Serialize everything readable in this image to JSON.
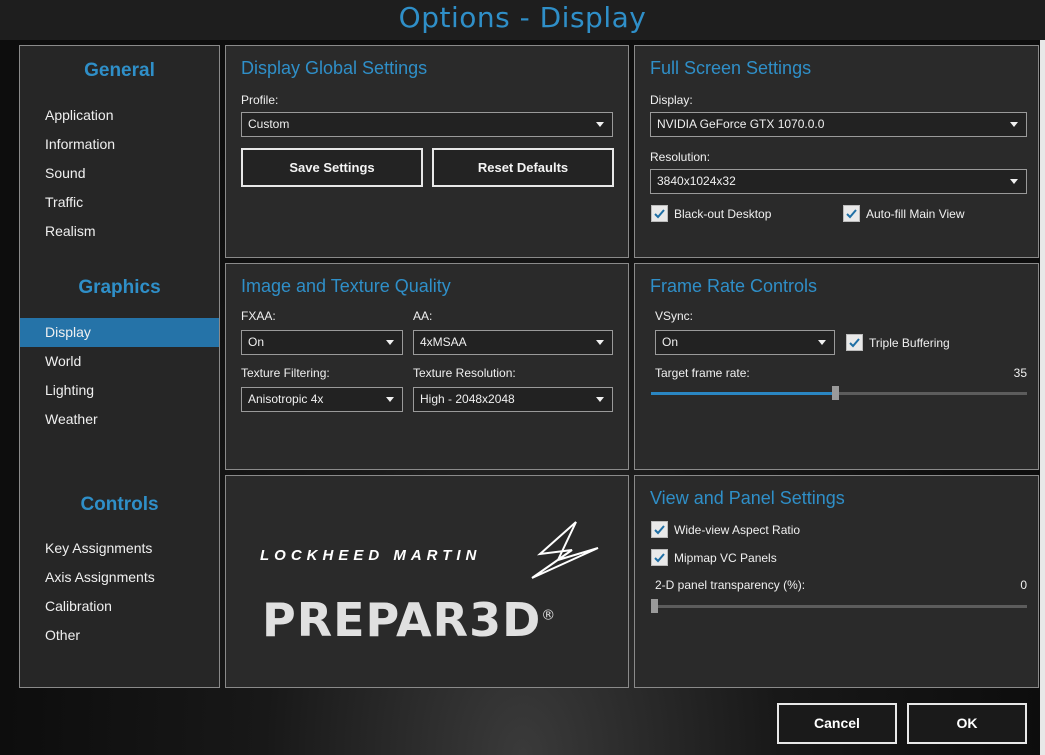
{
  "window": {
    "title": "Options - Display"
  },
  "sidebar": {
    "sections": [
      {
        "heading": "General",
        "items": [
          "Application",
          "Information",
          "Sound",
          "Traffic",
          "Realism"
        ]
      },
      {
        "heading": "Graphics",
        "items": [
          "Display",
          "World",
          "Lighting",
          "Weather"
        ]
      },
      {
        "heading": "Controls",
        "items": [
          "Key Assignments",
          "Axis Assignments",
          "Calibration",
          "Other"
        ]
      }
    ],
    "active_item": "Display"
  },
  "display_global": {
    "title": "Display Global Settings",
    "profile_label": "Profile:",
    "profile_value": "Custom",
    "save_label": "Save Settings",
    "reset_label": "Reset Defaults"
  },
  "full_screen": {
    "title": "Full Screen Settings",
    "display_label": "Display:",
    "display_value": "NVIDIA GeForce GTX 1070.0.0",
    "resolution_label": "Resolution:",
    "resolution_value": "3840x1024x32",
    "blackout_label": "Black-out Desktop",
    "blackout_checked": true,
    "autofill_label": "Auto-fill Main View",
    "autofill_checked": true
  },
  "image_quality": {
    "title": "Image and Texture Quality",
    "fxaa_label": "FXAA:",
    "fxaa_value": "On",
    "aa_label": "AA:",
    "aa_value": "4xMSAA",
    "filtering_label": "Texture Filtering:",
    "filtering_value": "Anisotropic 4x",
    "tex_res_label": "Texture Resolution:",
    "tex_res_value": "High - 2048x2048"
  },
  "frame_rate": {
    "title": "Frame Rate Controls",
    "vsync_label": "VSync:",
    "vsync_value": "On",
    "triple_label": "Triple Buffering",
    "triple_checked": true,
    "target_label": "Target frame rate:",
    "target_value": "35",
    "target_fraction": 0.49
  },
  "logo": {
    "company": "LOCKHEED MARTIN",
    "product": "PREPAR3D",
    "registered": "®"
  },
  "view_panel": {
    "title": "View and Panel Settings",
    "wideview_label": "Wide-view Aspect Ratio",
    "wideview_checked": true,
    "mipmap_label": "Mipmap VC Panels",
    "mipmap_checked": true,
    "transparency_label": "2-D panel transparency (%):",
    "transparency_value": "0",
    "transparency_fraction": 0.0
  },
  "footer": {
    "cancel_label": "Cancel",
    "ok_label": "OK"
  },
  "colors": {
    "accent": "#2f8fc8",
    "active": "#2573a8",
    "panel": "#2a2a2a"
  }
}
